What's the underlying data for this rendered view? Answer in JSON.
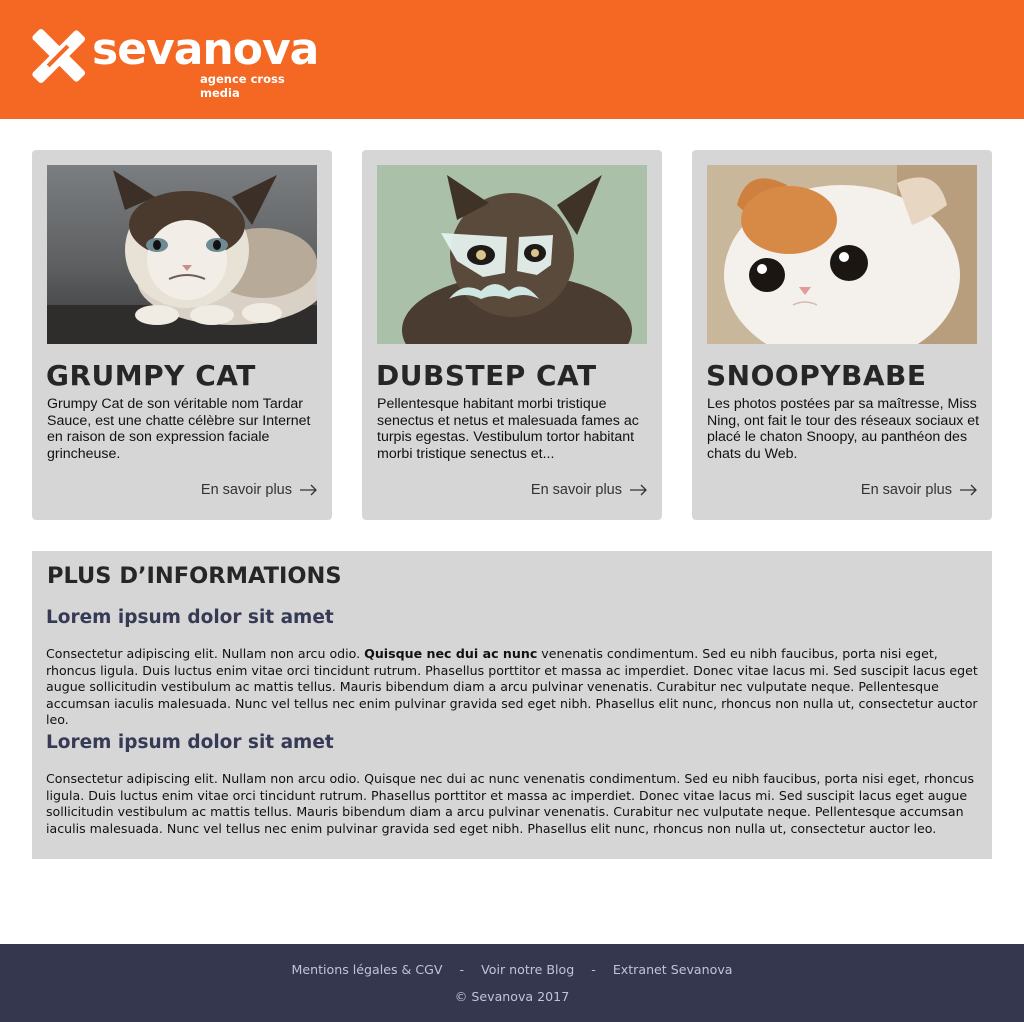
{
  "header": {
    "brand_name": "sevanova",
    "brand_tagline": "agence cross media",
    "color": "#f46824"
  },
  "cards": [
    {
      "title": "GRUMPY CAT",
      "text": "Grumpy Cat de son véritable nom Tardar Sauce, est une chatte célèbre sur Internet en raison de son expression faciale grincheuse.",
      "link_label": "En savoir plus",
      "photo": "grumpy-cat-photo"
    },
    {
      "title": "DUBSTEP CAT",
      "text": "Pellentesque habitant morbi tristique senectus et netus et malesuada fames ac turpis egestas. Vestibulum tortor habitant morbi tristique senectus et...",
      "link_label": "En savoir plus",
      "photo": "dubstep-cat-photo"
    },
    {
      "title": "SNOOPYBABE",
      "text": "Les photos postées par sa maîtresse, Miss Ning, ont fait le tour des réseaux sociaux et placé le chaton Snoopy, au panthéon des chats du Web.",
      "link_label": "En savoir plus",
      "photo": "snoopybabe-photo"
    }
  ],
  "info": {
    "title": "PLUS D’INFORMATIONS",
    "sections": [
      {
        "heading": "Lorem ipsum dolor sit amet",
        "text_before": "Consectetur adipiscing elit. Nullam non arcu odio. ",
        "text_bold": "Quisque nec dui ac nunc",
        "text_after": " venenatis condimentum. Sed eu nibh faucibus, porta nisi eget, rhoncus ligula. Duis luctus enim vitae orci tincidunt rutrum. Phasellus porttitor et massa ac imperdiet. Donec vitae lacus mi. Sed suscipit lacus eget augue sollicitudin vestibulum ac mattis tellus. Mauris bibendum diam a arcu pulvinar venenatis. Curabitur nec vulputate neque. Pellentesque accumsan iaculis malesuada. Nunc vel tellus nec enim pulvinar gravida sed eget nibh. Phasellus elit nunc, rhoncus non nulla ut, consectetur auctor leo."
      },
      {
        "heading": "Lorem ipsum dolor sit amet",
        "text": "Consectetur adipiscing elit. Nullam non arcu odio. Quisque nec dui ac nunc venenatis condimentum. Sed eu nibh faucibus, porta nisi eget, rhoncus ligula. Duis luctus enim vitae orci tincidunt rutrum. Phasellus porttitor et massa ac imperdiet. Donec vitae lacus mi. Sed suscipit lacus eget augue sollicitudin vestibulum ac mattis tellus. Mauris bibendum diam a arcu pulvinar venenatis. Curabitur nec vulputate neque. Pellentesque accumsan iaculis malesuada. Nunc vel tellus nec enim pulvinar gravida sed eget nibh. Phasellus elit nunc, rhoncus non nulla ut, consectetur auctor leo."
      }
    ]
  },
  "footer": {
    "links": [
      "Mentions légales & CGV",
      "Voir notre Blog",
      "Extranet Sevanova"
    ],
    "separator": "-",
    "copyright": "© Sevanova 2017",
    "color": "#35374f"
  }
}
